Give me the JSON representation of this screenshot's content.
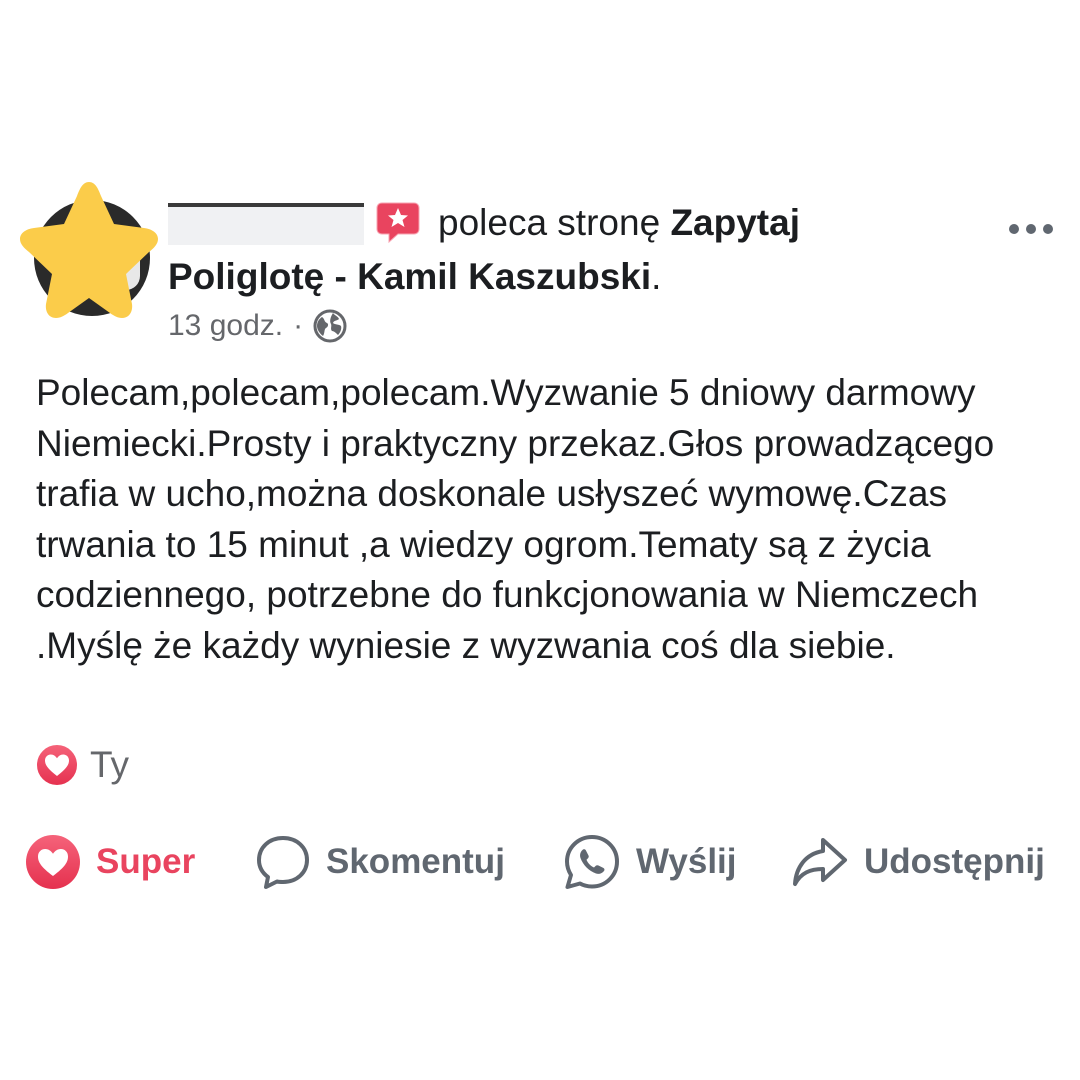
{
  "post": {
    "author_action": "poleca stronę",
    "page_name": "Zapytaj Poliglotę - Kamil Kaszubski",
    "trailing_period": ".",
    "time": "13 godz.",
    "separator": "·",
    "privacy_icon": "globe-icon",
    "body": "Polecam,polecam,polecam.Wyzwanie 5 dniowy darmowy Niemiecki.Prosty i praktyczny przekaz.Głos prowadzącego trafia w ucho,można doskonale usłyszeć wymowę.Czas trwania to 15 minut ,a wiedzy ogrom.Tematy są z życia codziennego, potrzebne do funkcjonowania w Niemczech .Myślę że każdy wyniesie z wyzwania coś dla siebie."
  },
  "reactions": {
    "summary_label": "Ty"
  },
  "actions": {
    "like_label": "Super",
    "comment_label": "Skomentuj",
    "send_label": "Wyślij",
    "share_label": "Udostępnij"
  },
  "colors": {
    "love": "#e9445f",
    "star": "#fbcc4a",
    "muted": "#65676b",
    "text": "#1c1e21"
  }
}
